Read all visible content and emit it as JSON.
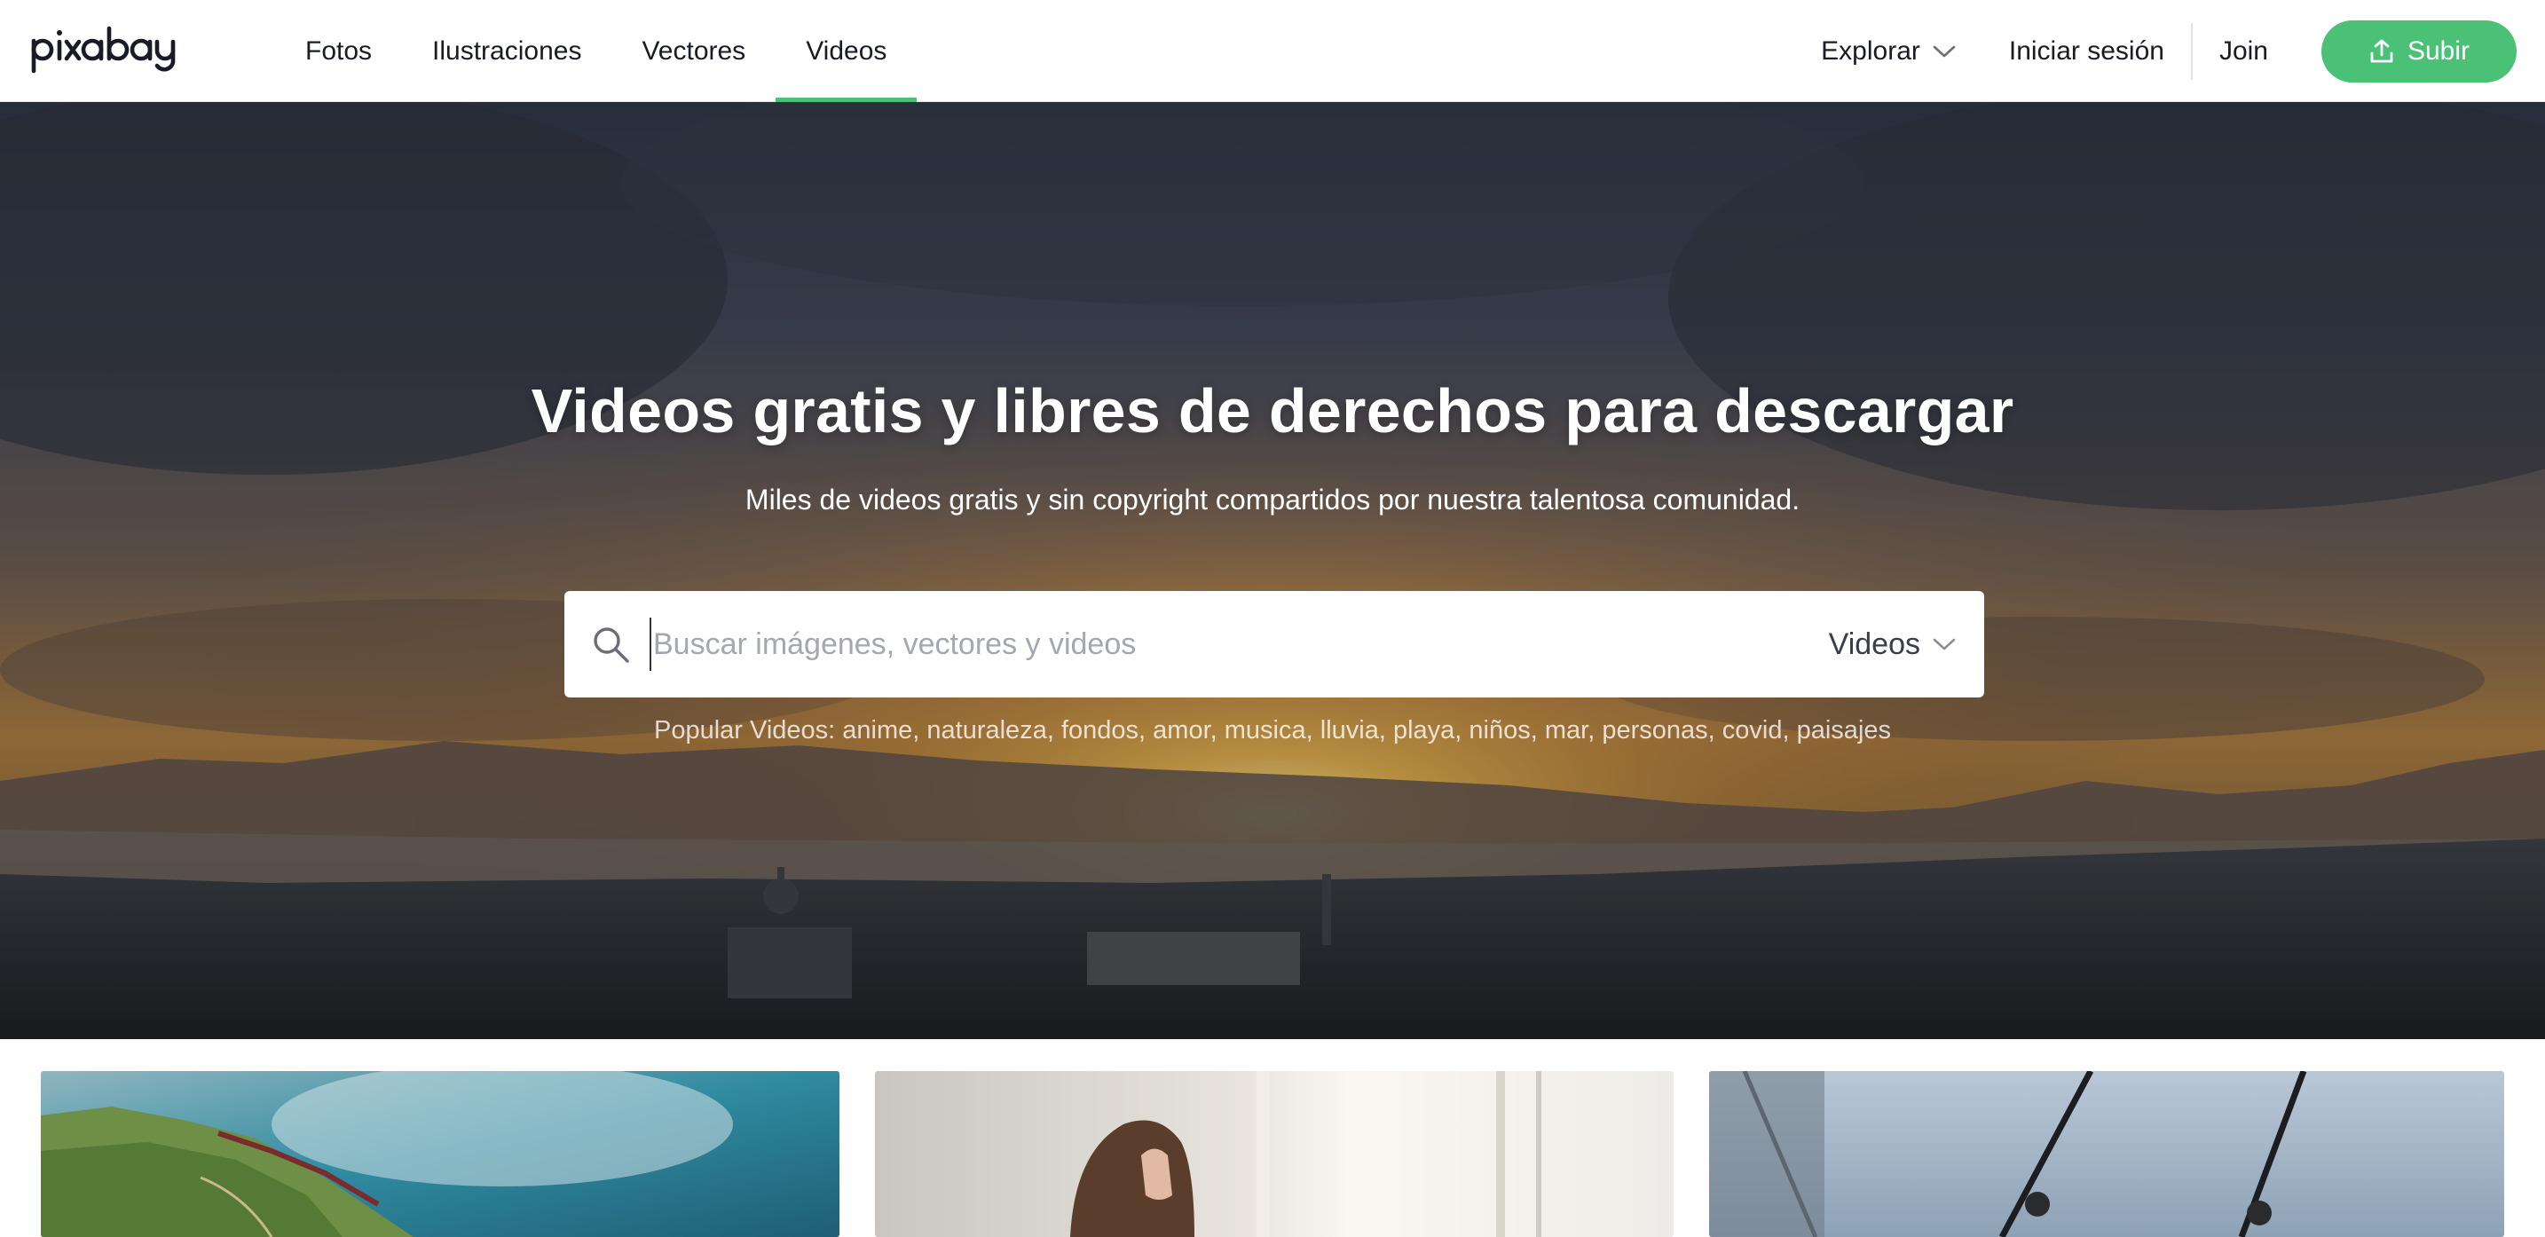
{
  "header": {
    "logo_text": "pixabay",
    "tabs": [
      {
        "label": "Fotos",
        "active": false
      },
      {
        "label": "Ilustraciones",
        "active": false
      },
      {
        "label": "Vectores",
        "active": false
      },
      {
        "label": "Videos",
        "active": true
      }
    ],
    "explore_label": "Explorar",
    "signin_label": "Iniciar sesión",
    "join_label": "Join",
    "upload_label": "Subir"
  },
  "hero": {
    "title": "Videos gratis y libres de derechos para descargar",
    "subtitle": "Miles de videos gratis y sin copyright compartidos por nuestra talentosa comunidad.",
    "search": {
      "placeholder": "Buscar imágenes, vectores y videos",
      "value": "",
      "type_selected": "Videos"
    },
    "popular_label": "Popular Videos:",
    "popular_terms": [
      "anime",
      "naturaleza",
      "fondos",
      "amor",
      "musica",
      "lluvia",
      "playa",
      "niños",
      "mar",
      "personas",
      "covid",
      "paisajes"
    ]
  },
  "colors": {
    "accent": "#4bc178",
    "text": "#191b26",
    "placeholder": "#a2a7b1"
  },
  "icons": {
    "search": "search-icon",
    "chevron": "chevron-down-icon",
    "upload": "upload-icon"
  },
  "thumbnails": [
    {
      "subject": "coastal-cliff-video"
    },
    {
      "subject": "woman-by-window-video"
    },
    {
      "subject": "fishing-rods-video"
    }
  ]
}
